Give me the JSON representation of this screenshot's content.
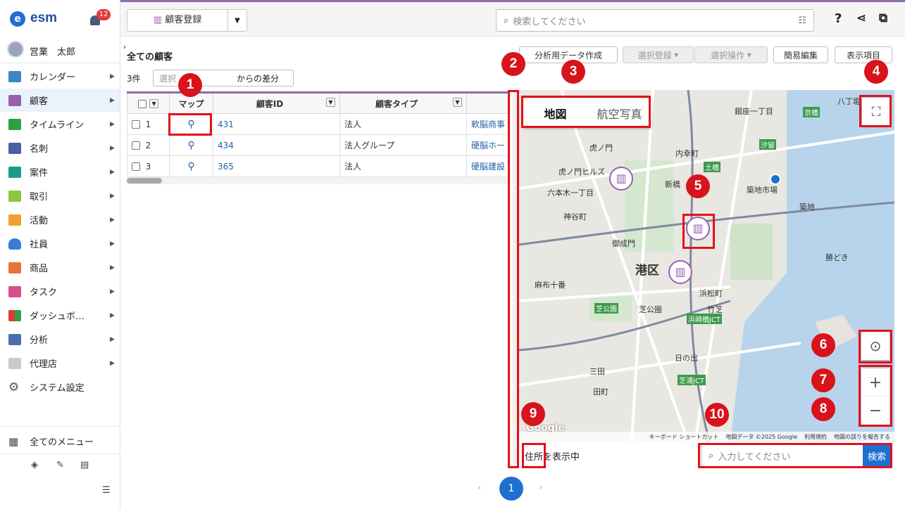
{
  "app": {
    "logo_letter": "e",
    "name": "esm",
    "notif_count": "12",
    "user": "営業　太郎"
  },
  "nav": [
    "カレンダー",
    "顧客",
    "タイムライン",
    "名刺",
    "案件",
    "取引",
    "活動",
    "社員",
    "商品",
    "タスク",
    "ダッシュボ…",
    "分析",
    "代理店",
    "システム設定"
  ],
  "all_menu": "全てのメニュー",
  "topbar": {
    "register_label": "顧客登録",
    "search_placeholder": "検索してください"
  },
  "list": {
    "title": "全ての顧客",
    "count": "3件",
    "diff_select": "選択",
    "diff_label": "からの差分",
    "buttons": {
      "analysis": "分析用データ作成",
      "select_register": "選択登録",
      "select_op": "選択操作",
      "quick_edit": "簡易編集",
      "display_items": "表示項目"
    },
    "columns": [
      "マップ",
      "顧客ID",
      "顧客タイプ"
    ],
    "rows": [
      {
        "no": "1",
        "id": "431",
        "type": "法人",
        "name": "軟脳商事"
      },
      {
        "no": "2",
        "id": "434",
        "type": "法人グループ",
        "name": "硬脳ホー"
      },
      {
        "no": "3",
        "id": "365",
        "type": "法人",
        "name": "硬脳建設"
      }
    ]
  },
  "map": {
    "tab_map": "地図",
    "tab_aerial": "航空写真",
    "ward": "港区",
    "labels": [
      "虎ノ門",
      "内幸町",
      "虎ノ門ヒルズ",
      "新橋",
      "六本木一丁目",
      "築地市場",
      "神谷町",
      "御成門",
      "麻布十番",
      "浜松町",
      "芝公園",
      "芝公園",
      "竹芝",
      "三田",
      "田町",
      "日の出",
      "芝浦JCT",
      "浜崎橋JCT",
      "勝どき",
      "銀座一丁目",
      "八丁堀",
      "京橋",
      "土橋",
      "築地",
      "汐留"
    ],
    "footer": [
      "キーボード ショートカット",
      "地図データ ©2025 Google",
      "利用規約",
      "地図の誤りを報告する"
    ],
    "google": "Google",
    "address_status": "住所を表示中",
    "search_placeholder": "入力してください",
    "search_button": "検索"
  },
  "page": "1",
  "callouts": [
    "1",
    "2",
    "3",
    "4",
    "5",
    "6",
    "7",
    "8",
    "9",
    "10"
  ],
  "colors": {
    "accent": "#8e6aa6",
    "primary": "#1f6fd1",
    "callout": "#d8131b"
  }
}
